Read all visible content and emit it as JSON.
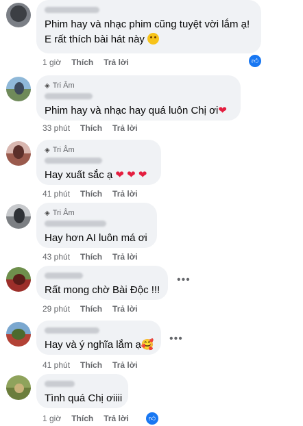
{
  "comments": [
    {
      "badge": "",
      "lines": [
        "Phim hay và nhạc phim cũng tuyệt vời lắm ạ!",
        "E rất thích bài hát này"
      ],
      "time": "1 giờ",
      "like": "Thích",
      "reply": "Trả lời",
      "reaction": "like-icon"
    },
    {
      "badge": "Tri Âm",
      "lines": [
        "Phim hay và nhạc hay quá luôn Chị ơi"
      ],
      "time": "33 phút",
      "like": "Thích",
      "reply": "Trả lời"
    },
    {
      "badge": "Tri Âm",
      "lines": [
        "Hay xuất sắc ạ"
      ],
      "time": "41 phút",
      "like": "Thích",
      "reply": "Trả lời"
    },
    {
      "badge": "Tri Âm",
      "lines": [
        "Hay hơn AI luôn má ơi"
      ],
      "time": "43 phút",
      "like": "Thích",
      "reply": "Trả lời"
    },
    {
      "badge": "",
      "lines": [
        "Rất mong chờ Bài Độc !!!"
      ],
      "time": "29 phút",
      "like": "Thích",
      "reply": "Trả lời"
    },
    {
      "badge": "",
      "lines": [
        "Hay và ý nghĩa lắm ạ"
      ],
      "time": "41 phút",
      "like": "Thích",
      "reply": "Trả lời"
    },
    {
      "badge": "",
      "lines": [
        "Tình quá Chị ơiiii"
      ],
      "time": "1 giờ",
      "like": "Thích",
      "reply": "Trả lời",
      "reaction": "like-icon"
    }
  ],
  "colors": {
    "bubble": "#f0f2f5",
    "meta": "#65676b",
    "like_blue": "#1877f2",
    "heart": "#e41e3f"
  }
}
